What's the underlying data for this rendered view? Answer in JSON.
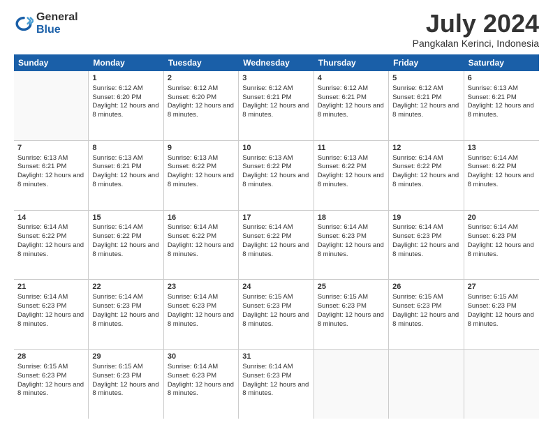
{
  "logo": {
    "general": "General",
    "blue": "Blue"
  },
  "title": "July 2024",
  "location": "Pangkalan Kerinci, Indonesia",
  "days": [
    "Sunday",
    "Monday",
    "Tuesday",
    "Wednesday",
    "Thursday",
    "Friday",
    "Saturday"
  ],
  "weeks": [
    [
      {
        "day": "",
        "empty": true
      },
      {
        "day": "1",
        "sunrise": "Sunrise: 6:12 AM",
        "sunset": "Sunset: 6:20 PM",
        "daylight": "Daylight: 12 hours and 8 minutes."
      },
      {
        "day": "2",
        "sunrise": "Sunrise: 6:12 AM",
        "sunset": "Sunset: 6:20 PM",
        "daylight": "Daylight: 12 hours and 8 minutes."
      },
      {
        "day": "3",
        "sunrise": "Sunrise: 6:12 AM",
        "sunset": "Sunset: 6:21 PM",
        "daylight": "Daylight: 12 hours and 8 minutes."
      },
      {
        "day": "4",
        "sunrise": "Sunrise: 6:12 AM",
        "sunset": "Sunset: 6:21 PM",
        "daylight": "Daylight: 12 hours and 8 minutes."
      },
      {
        "day": "5",
        "sunrise": "Sunrise: 6:12 AM",
        "sunset": "Sunset: 6:21 PM",
        "daylight": "Daylight: 12 hours and 8 minutes."
      },
      {
        "day": "6",
        "sunrise": "Sunrise: 6:13 AM",
        "sunset": "Sunset: 6:21 PM",
        "daylight": "Daylight: 12 hours and 8 minutes."
      }
    ],
    [
      {
        "day": "7",
        "sunrise": "Sunrise: 6:13 AM",
        "sunset": "Sunset: 6:21 PM",
        "daylight": "Daylight: 12 hours and 8 minutes."
      },
      {
        "day": "8",
        "sunrise": "Sunrise: 6:13 AM",
        "sunset": "Sunset: 6:21 PM",
        "daylight": "Daylight: 12 hours and 8 minutes."
      },
      {
        "day": "9",
        "sunrise": "Sunrise: 6:13 AM",
        "sunset": "Sunset: 6:22 PM",
        "daylight": "Daylight: 12 hours and 8 minutes."
      },
      {
        "day": "10",
        "sunrise": "Sunrise: 6:13 AM",
        "sunset": "Sunset: 6:22 PM",
        "daylight": "Daylight: 12 hours and 8 minutes."
      },
      {
        "day": "11",
        "sunrise": "Sunrise: 6:13 AM",
        "sunset": "Sunset: 6:22 PM",
        "daylight": "Daylight: 12 hours and 8 minutes."
      },
      {
        "day": "12",
        "sunrise": "Sunrise: 6:14 AM",
        "sunset": "Sunset: 6:22 PM",
        "daylight": "Daylight: 12 hours and 8 minutes."
      },
      {
        "day": "13",
        "sunrise": "Sunrise: 6:14 AM",
        "sunset": "Sunset: 6:22 PM",
        "daylight": "Daylight: 12 hours and 8 minutes."
      }
    ],
    [
      {
        "day": "14",
        "sunrise": "Sunrise: 6:14 AM",
        "sunset": "Sunset: 6:22 PM",
        "daylight": "Daylight: 12 hours and 8 minutes."
      },
      {
        "day": "15",
        "sunrise": "Sunrise: 6:14 AM",
        "sunset": "Sunset: 6:22 PM",
        "daylight": "Daylight: 12 hours and 8 minutes."
      },
      {
        "day": "16",
        "sunrise": "Sunrise: 6:14 AM",
        "sunset": "Sunset: 6:22 PM",
        "daylight": "Daylight: 12 hours and 8 minutes."
      },
      {
        "day": "17",
        "sunrise": "Sunrise: 6:14 AM",
        "sunset": "Sunset: 6:22 PM",
        "daylight": "Daylight: 12 hours and 8 minutes."
      },
      {
        "day": "18",
        "sunrise": "Sunrise: 6:14 AM",
        "sunset": "Sunset: 6:23 PM",
        "daylight": "Daylight: 12 hours and 8 minutes."
      },
      {
        "day": "19",
        "sunrise": "Sunrise: 6:14 AM",
        "sunset": "Sunset: 6:23 PM",
        "daylight": "Daylight: 12 hours and 8 minutes."
      },
      {
        "day": "20",
        "sunrise": "Sunrise: 6:14 AM",
        "sunset": "Sunset: 6:23 PM",
        "daylight": "Daylight: 12 hours and 8 minutes."
      }
    ],
    [
      {
        "day": "21",
        "sunrise": "Sunrise: 6:14 AM",
        "sunset": "Sunset: 6:23 PM",
        "daylight": "Daylight: 12 hours and 8 minutes."
      },
      {
        "day": "22",
        "sunrise": "Sunrise: 6:14 AM",
        "sunset": "Sunset: 6:23 PM",
        "daylight": "Daylight: 12 hours and 8 minutes."
      },
      {
        "day": "23",
        "sunrise": "Sunrise: 6:14 AM",
        "sunset": "Sunset: 6:23 PM",
        "daylight": "Daylight: 12 hours and 8 minutes."
      },
      {
        "day": "24",
        "sunrise": "Sunrise: 6:15 AM",
        "sunset": "Sunset: 6:23 PM",
        "daylight": "Daylight: 12 hours and 8 minutes."
      },
      {
        "day": "25",
        "sunrise": "Sunrise: 6:15 AM",
        "sunset": "Sunset: 6:23 PM",
        "daylight": "Daylight: 12 hours and 8 minutes."
      },
      {
        "day": "26",
        "sunrise": "Sunrise: 6:15 AM",
        "sunset": "Sunset: 6:23 PM",
        "daylight": "Daylight: 12 hours and 8 minutes."
      },
      {
        "day": "27",
        "sunrise": "Sunrise: 6:15 AM",
        "sunset": "Sunset: 6:23 PM",
        "daylight": "Daylight: 12 hours and 8 minutes."
      }
    ],
    [
      {
        "day": "28",
        "sunrise": "Sunrise: 6:15 AM",
        "sunset": "Sunset: 6:23 PM",
        "daylight": "Daylight: 12 hours and 8 minutes."
      },
      {
        "day": "29",
        "sunrise": "Sunrise: 6:15 AM",
        "sunset": "Sunset: 6:23 PM",
        "daylight": "Daylight: 12 hours and 8 minutes."
      },
      {
        "day": "30",
        "sunrise": "Sunrise: 6:14 AM",
        "sunset": "Sunset: 6:23 PM",
        "daylight": "Daylight: 12 hours and 8 minutes."
      },
      {
        "day": "31",
        "sunrise": "Sunrise: 6:14 AM",
        "sunset": "Sunset: 6:23 PM",
        "daylight": "Daylight: 12 hours and 8 minutes."
      },
      {
        "day": "",
        "empty": true
      },
      {
        "day": "",
        "empty": true
      },
      {
        "day": "",
        "empty": true
      }
    ]
  ]
}
